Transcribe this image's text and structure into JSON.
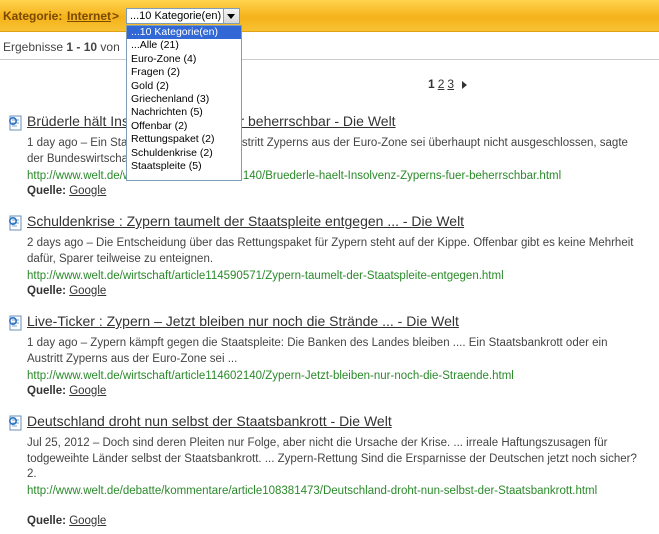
{
  "category_bar": {
    "label": "Kategorie:",
    "link": "Internet",
    "arrow": ">",
    "selected": "...10 Kategorie(en)"
  },
  "dropdown": {
    "options": [
      "...10 Kategorie(en)",
      "...Alle  (21)",
      "Euro-Zone  (4)",
      "Fragen  (2)",
      "Gold  (2)",
      "Griechenland  (3)",
      "Nachrichten  (5)",
      "Offenbar  (2)",
      "Rettungspaket  (2)",
      "Schuldenkrise  (2)",
      "Staatspleite  (5)"
    ]
  },
  "results_bar": {
    "prefix": "Ergebnisse ",
    "range": "1 - 10",
    "suffix": " von"
  },
  "pager": {
    "current": "1",
    "pages": [
      "2",
      "3"
    ]
  },
  "results": [
    {
      "title": "Brüderle hält Insolvenz Zyperns für beherrschbar - Die Welt",
      "snippet": "1 day ago – Ein Staatsbankrott und ein Austritt Zyperns aus der Euro-Zone sei überhaupt nicht ausgeschlossen, sagte der Bundeswirtschaftsminister.",
      "url": "http://www.welt.de/wirtschaft/article114602140/Bruederle-haelt-Insolvenz-Zyperns-fuer-beherrschbar.html",
      "source_label": "Quelle:",
      "source": "Google"
    },
    {
      "title": "Schuldenkrise : Zypern taumelt der Staatspleite entgegen ... - Die Welt",
      "snippet": "2 days ago – Die Entscheidung über das Rettungspaket für Zypern steht auf der Kippe. Offenbar gibt es keine Mehrheit dafür, Sparer teilweise zu enteignen.",
      "url": "http://www.welt.de/wirtschaft/article114590571/Zypern-taumelt-der-Staatspleite-entgegen.html",
      "source_label": "Quelle:",
      "source": "Google"
    },
    {
      "title": "Live-Ticker : Zypern – Jetzt bleiben nur noch die Strände ... - Die Welt",
      "snippet": "1 day ago – Zypern kämpft gegen die Staatspleite: Die Banken des Landes bleiben .... Ein Staatsbankrott oder ein Austritt Zyperns aus der Euro-Zone sei ...",
      "url": "http://www.welt.de/wirtschaft/article114602140/Zypern-Jetzt-bleiben-nur-noch-die-Straende.html",
      "source_label": "Quelle:",
      "source": "Google"
    },
    {
      "title": "Deutschland droht nun selbst der Staatsbankrott - Die Welt",
      "snippet": "Jul 25, 2012 – Doch sind deren Pleiten nur Folge, aber nicht die Ursache der Krise. ... irreale Haftungszusagen für todgeweihte Länder selbst der Staatsbankrott. ... Zypern-Rettung Sind die Ersparnisse der Deutschen jetzt noch sicher? 2.",
      "url": "http://www.welt.de/debatte/kommentare/article108381473/Deutschland-droht-nun-selbst-der-Staatsbankrott.html",
      "source_label": "Quelle:",
      "source": "Google"
    }
  ]
}
